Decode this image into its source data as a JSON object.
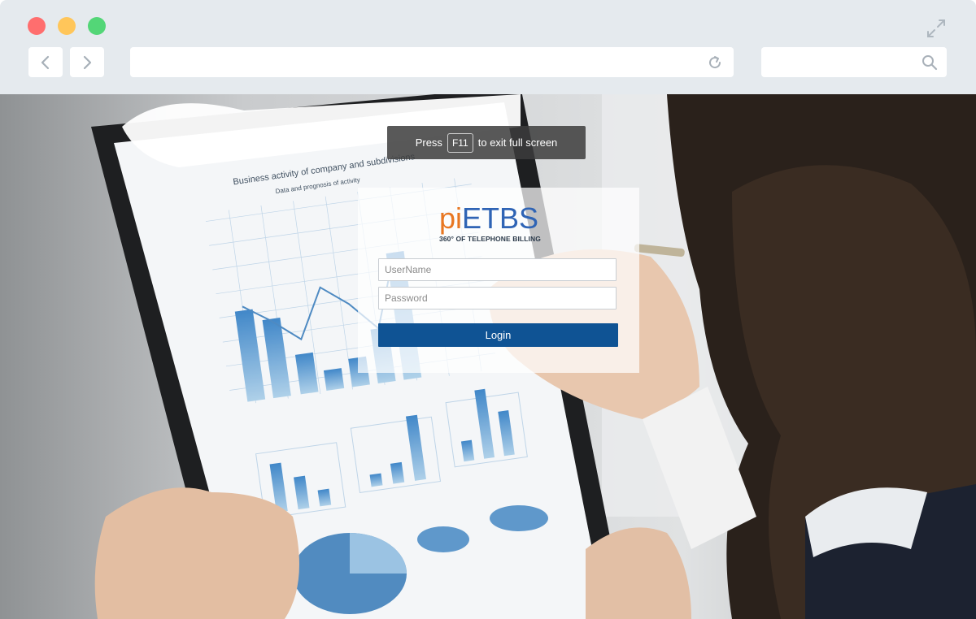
{
  "window": {
    "controls": [
      "close-dot",
      "minimize-dot",
      "maximize-dot"
    ],
    "expand_icon": "expand-arrows-icon"
  },
  "navigation": {
    "back_icon": "chevron-left-icon",
    "forward_icon": "chevron-right-icon",
    "reload_icon": "reload-icon",
    "search_icon": "search-icon"
  },
  "address_bar": {
    "value": ""
  },
  "search_bar": {
    "value": ""
  },
  "fullscreen_notice": {
    "prefix": "Press",
    "key": "F11",
    "suffix": "to exit full screen"
  },
  "login": {
    "logo_pi": "pi",
    "logo_etbs": "ETBS",
    "tagline": "360° OF TELEPHONE BILLING",
    "username_placeholder": "UserName",
    "password_placeholder": "Password",
    "login_label": "Login"
  },
  "colors": {
    "chrome_bg": "#e5eaee",
    "brand_orange": "#e87722",
    "brand_blue": "#2f64b5",
    "login_button": "#0f5394"
  }
}
